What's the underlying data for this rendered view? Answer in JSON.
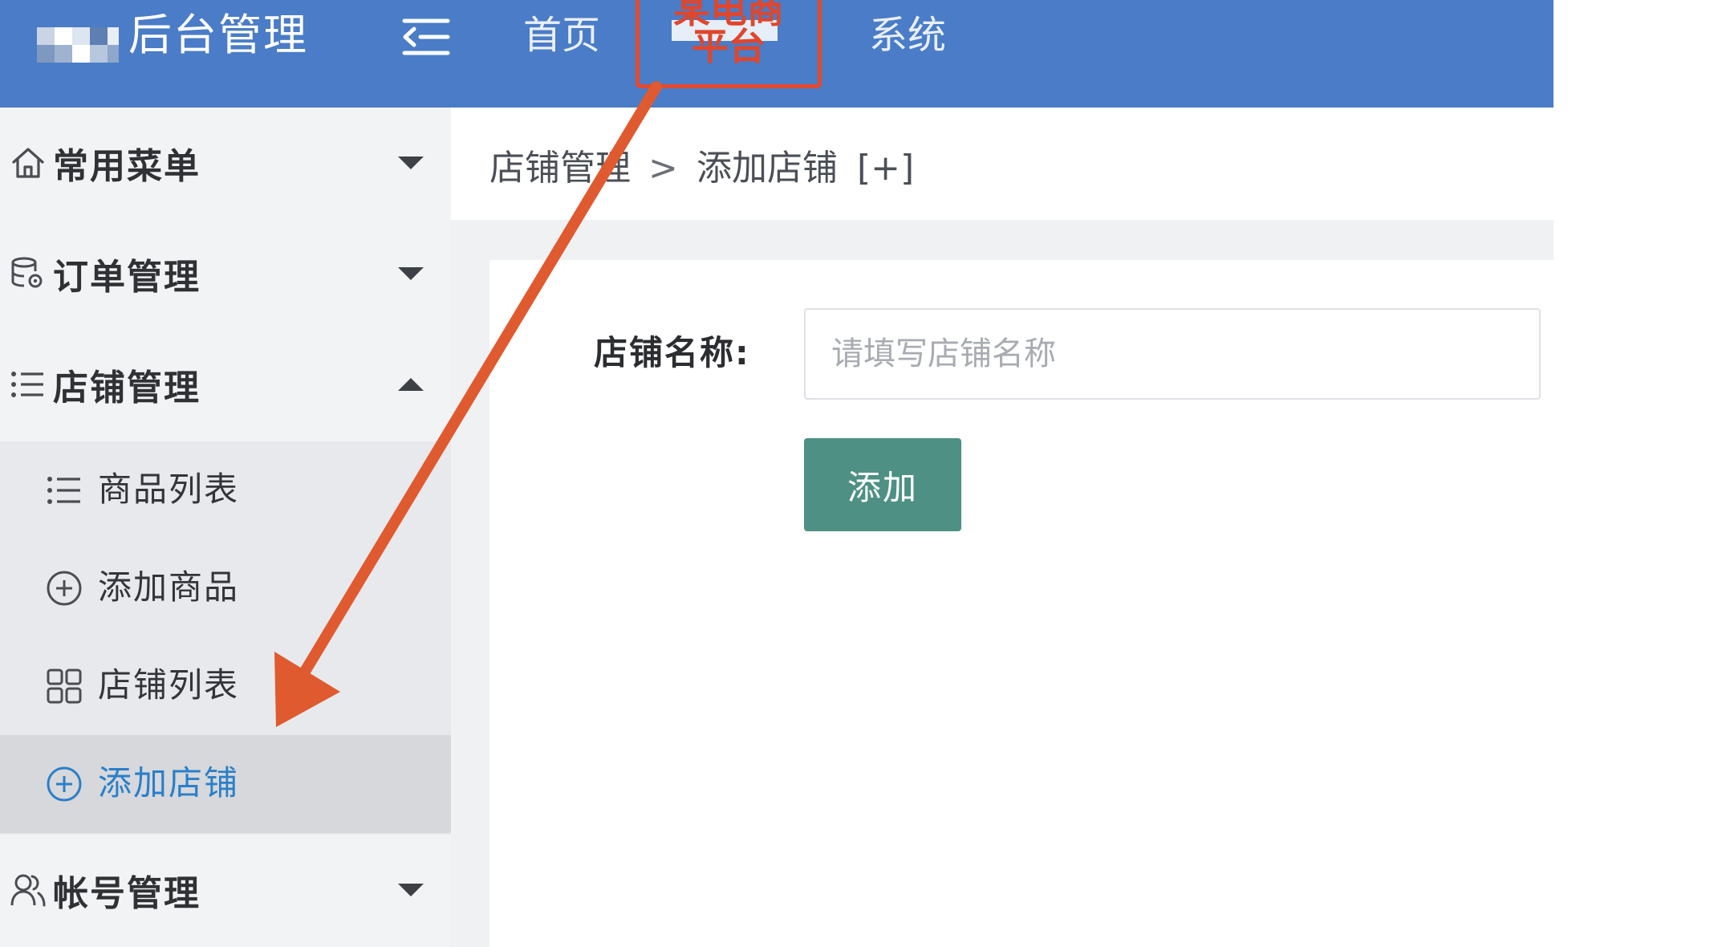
{
  "header": {
    "app_title": "后台管理",
    "menu_toggle_icon": "indent-icon",
    "nav": {
      "home": "首页",
      "active_line1": "某电商",
      "active_line2": "平台",
      "system": "系统"
    },
    "colors": {
      "bar": "#4a7cc7",
      "highlight": "#e34a2e"
    }
  },
  "sidebar": {
    "groups": [
      {
        "icon": "home-icon",
        "label": "常用菜单",
        "state": "collapsed"
      },
      {
        "icon": "database-gear-icon",
        "label": "订单管理",
        "state": "collapsed"
      },
      {
        "icon": "list-icon",
        "label": "店铺管理",
        "state": "expanded"
      },
      {
        "icon": "users-icon",
        "label": "帐号管理",
        "state": "collapsed"
      }
    ],
    "submenu": [
      {
        "icon": "list-icon",
        "label": "商品列表"
      },
      {
        "icon": "plus-circle-icon",
        "label": "添加商品"
      },
      {
        "icon": "grid-icon",
        "label": "店铺列表"
      },
      {
        "icon": "plus-circle-icon",
        "label": "添加店铺",
        "active": true
      }
    ],
    "active_color": "#2b7fc8"
  },
  "breadcrumb": {
    "parent": "店铺管理",
    "separator": ">",
    "current": "添加店铺",
    "action": "[+]"
  },
  "form": {
    "name_label": "店铺名称:",
    "name_placeholder": "请填写店铺名称",
    "name_value": "",
    "submit_label": "添加",
    "submit_color": "#4e9084"
  },
  "annotation": {
    "arrow_color": "#e05a30"
  }
}
